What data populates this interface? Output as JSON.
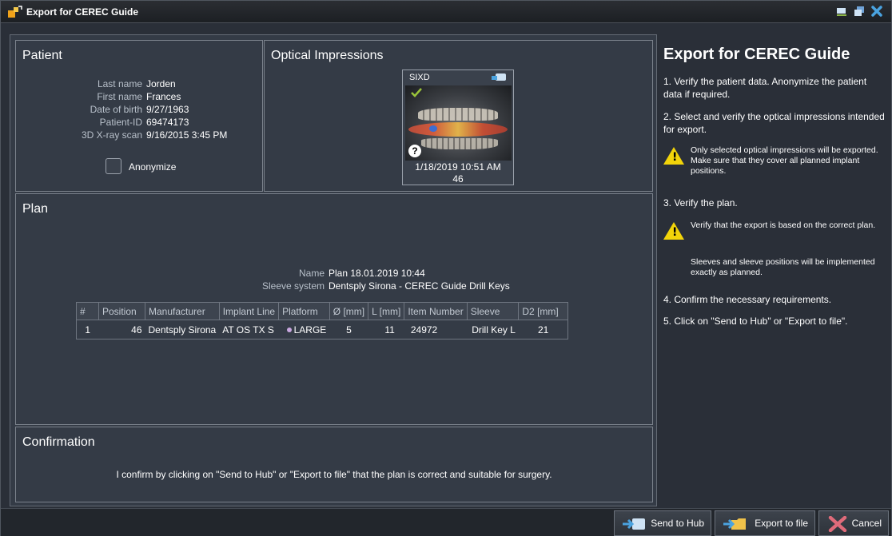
{
  "window": {
    "title": "Export for CEREC Guide",
    "controls": [
      "minimize-icon",
      "restore-icon",
      "close-icon"
    ]
  },
  "patient": {
    "heading": "Patient",
    "fields": [
      {
        "label": "Last name",
        "value": "Jorden"
      },
      {
        "label": "First name",
        "value": "Frances"
      },
      {
        "label": "Date of birth",
        "value": "9/27/1963"
      },
      {
        "label": "Patient-ID",
        "value": "69474173"
      },
      {
        "label": "3D X-ray scan",
        "value": "9/16/2015 3:45 PM"
      }
    ],
    "anonymize_label": "Anonymize",
    "anonymize_checked": false
  },
  "optical": {
    "heading": "Optical Impressions",
    "card": {
      "source": "SIXD",
      "date": "1/18/2019 10:51 AM",
      "tooth": "46",
      "selected": true
    }
  },
  "plan": {
    "heading": "Plan",
    "name_label": "Name",
    "name_value": "Plan 18.01.2019 10:44",
    "sleeve_label": "Sleeve system",
    "sleeve_value": "Dentsply Sirona - CEREC Guide Drill Keys",
    "table": {
      "columns": [
        "#",
        "Position",
        "Manufacturer",
        "Implant Line",
        "Platform",
        "Ø [mm]",
        "L [mm]",
        "Item Number",
        "Sleeve",
        "D2 [mm]"
      ],
      "rows": [
        [
          "1",
          "46",
          "Dentsply Sirona",
          "AT OS TX S",
          "LARGE",
          "5",
          "11",
          "24972",
          "Drill Key L",
          "21"
        ]
      ]
    }
  },
  "confirmation": {
    "heading": "Confirmation",
    "text": "I confirm by clicking on \"Send to Hub\" or \"Export to file\" that the plan is correct and suitable for surgery."
  },
  "help": {
    "title": "Export for CEREC Guide",
    "step1": "1. Verify the patient data. Anonymize the patient data if required.",
    "step2": "2. Select and verify the optical impressions intended for export.",
    "warn1": "Only selected optical impressions will be exported. Make sure that they cover all planned implant positions.",
    "step3": "3. Verify the plan.",
    "warn2": "Verify that the export is based on the correct plan.",
    "note": "Sleeves and sleeve positions will be implemented exactly as planned.",
    "step4": "4. Confirm the necessary requirements.",
    "step5": "5. Click on \"Send to Hub\" or \"Export to file\"."
  },
  "buttons": {
    "send": "Send to Hub",
    "export": "Export to file",
    "cancel": "Cancel"
  },
  "colors": {
    "platform_dot": "#c9a7e0",
    "warning": "#f2d40a",
    "check": "#9ac43a"
  }
}
